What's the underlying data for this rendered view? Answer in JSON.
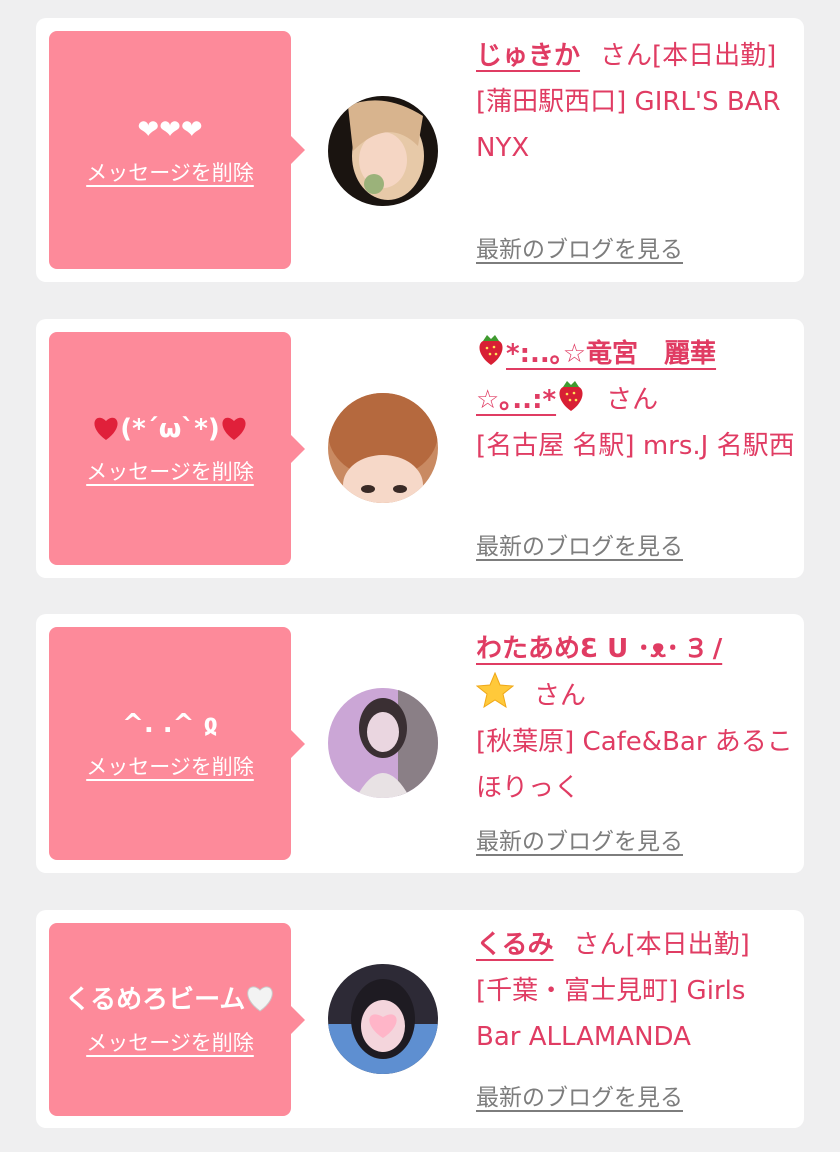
{
  "cards": [
    {
      "message": "❤❤❤",
      "delete_label": "メッセージを削除",
      "name": "じゅきか",
      "honorific": "さん",
      "status": "[本日出勤]",
      "shop": "[蒲田駅西口] GIRL'S BAR NYX",
      "blog_label": "最新のブログを見る",
      "avatar_colors": [
        "#1a1410",
        "#e7c9a8",
        "#f5d6c4"
      ]
    },
    {
      "message_pre": "",
      "message_mid": "(*´ω`*)",
      "message_post": "",
      "delete_label": "メッセージを削除",
      "name_pre": "",
      "name_mid": "*:..｡☆竜宮　麗華☆｡..:*",
      "name_post": "",
      "honorific": "さん",
      "shop": "[名古屋 名駅] mrs.J 名駅西",
      "blog_label": "最新のブログを見る",
      "avatar_colors": [
        "#b5693e",
        "#e8b89c",
        "#f6d8c8"
      ]
    },
    {
      "message": "^. .^ ჲ",
      "delete_label": "メッセージを削除",
      "name": "わたあめƐ U ･ᴥ･ Ɜ / ",
      "honorific": "さん",
      "shop": "[秋葉原] Cafe&Bar あるこほりっく",
      "blog_label": "最新のブログを見る",
      "avatar_colors": [
        "#cba6d6",
        "#3a2f33",
        "#ead6e0"
      ]
    },
    {
      "message": "くるめろビーム",
      "delete_label": "メッセージを削除",
      "name": "くるみ",
      "honorific": "さん",
      "status": "[本日出勤]",
      "shop": "[千葉・富士見町] Girls Bar ALLAMANDA",
      "blog_label": "最新のブログを見る",
      "avatar_colors": [
        "#2d2a36",
        "#5e8fd1",
        "#f4d5dc"
      ]
    }
  ],
  "colors": {
    "accent": "#e03c63",
    "bubble": "#fd8a9a",
    "link_gray": "#7d7d7d",
    "background": "#efeff0"
  }
}
